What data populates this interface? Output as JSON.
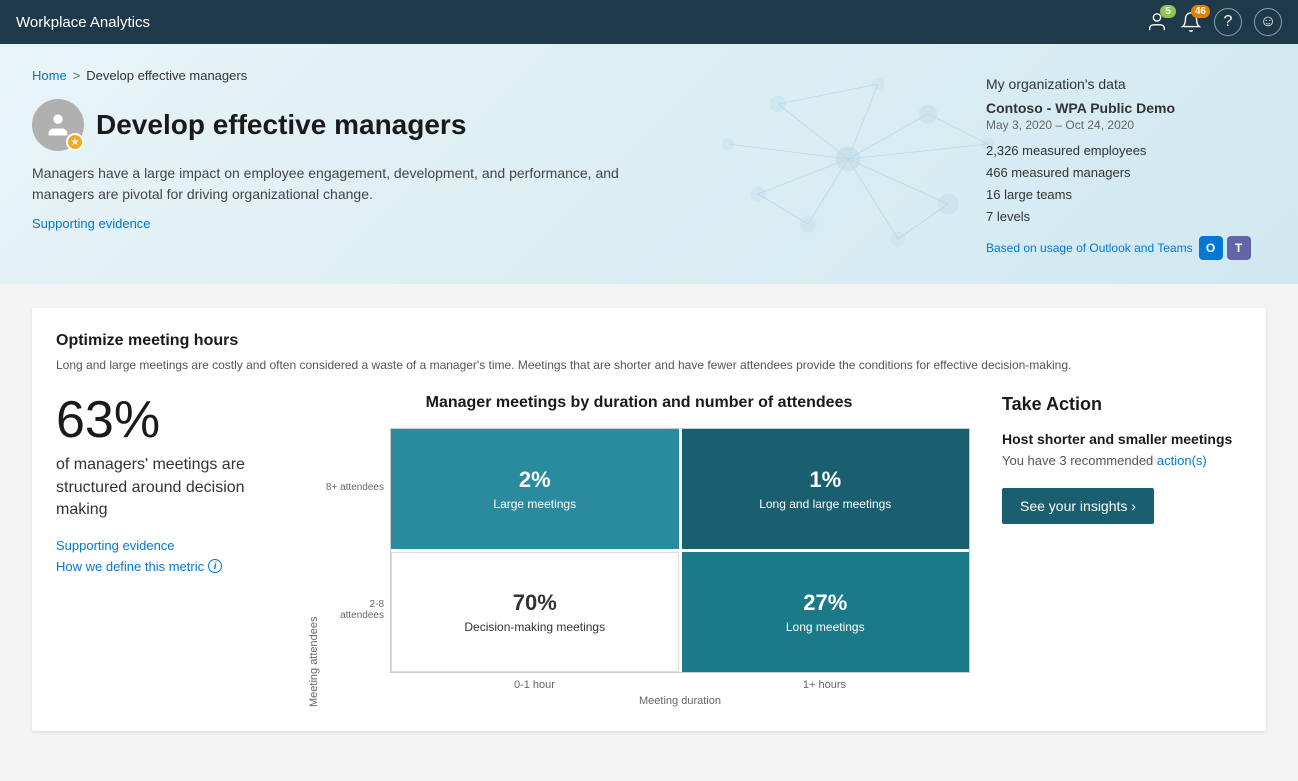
{
  "app": {
    "title": "Workplace Analytics"
  },
  "topnav": {
    "title": "Workplace Analytics",
    "badge1": "5",
    "badge2": "46",
    "icons": [
      "bell",
      "notification",
      "help",
      "smiley"
    ]
  },
  "breadcrumb": {
    "home": "Home",
    "separator": ">",
    "current": "Develop effective managers"
  },
  "hero": {
    "title": "Develop effective managers",
    "description": "Managers have a large impact on employee engagement, development, and performance, and managers are pivotal for driving organizational change.",
    "supporting_link": "Supporting evidence"
  },
  "org_data": {
    "section_title": "My organization's data",
    "company": "Contoso - WPA Public Demo",
    "dates": "May 3, 2020 – Oct 24, 2020",
    "stat1": "2,326 measured employees",
    "stat2": "466 measured managers",
    "stat3": "16 large teams",
    "stat4": "7 levels",
    "footer_text": "Based on usage of Outlook and Teams"
  },
  "card1": {
    "title": "Optimize meeting hours",
    "description": "Long and large meetings are costly and often considered a waste of a manager's time. Meetings that are shorter and have fewer attendees provide the conditions for effective decision-making.",
    "metric_value": "63%",
    "metric_label": "of managers' meetings are structured around decision making",
    "supporting_link": "Supporting evidence",
    "define_link": "How we define this metric",
    "chart_title": "Manager meetings by duration and number of attendees",
    "chart": {
      "cells": {
        "top_left": {
          "pct": "2%",
          "label": "Large meetings"
        },
        "top_right": {
          "pct": "1%",
          "label": "Long and large meetings"
        },
        "bottom_left": {
          "pct": "70%",
          "label": "Decision-making meetings"
        },
        "bottom_right": {
          "pct": "27%",
          "label": "Long meetings"
        }
      },
      "y_title": "Meeting attendees",
      "y_label_top": "8+ attendees",
      "y_label_bottom": "2-8 attendees",
      "x_label_left": "0-1 hour",
      "x_label_right": "1+ hours",
      "x_title": "Meeting duration"
    },
    "action": {
      "title": "Take Action",
      "subtitle": "Host shorter and smaller meetings",
      "description_text": "You have 3 recommended ",
      "description_link": "action(s)",
      "button": "See your insights ›"
    }
  }
}
